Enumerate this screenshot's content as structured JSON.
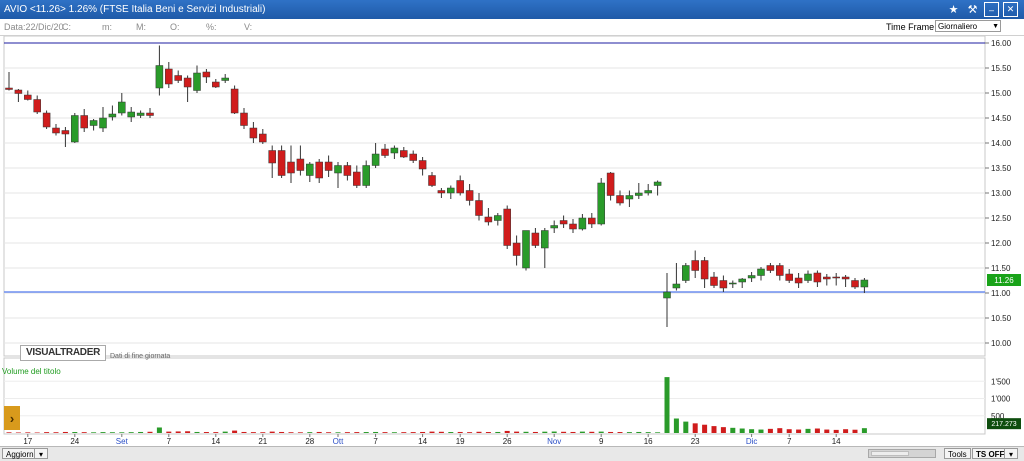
{
  "window": {
    "title": "AVIO <11.26> 1.26%  (FTSE Italia Beni e Servizi Industriali)",
    "icons": [
      "star-icon",
      "hammer-icon",
      "minimize-icon",
      "close-icon"
    ]
  },
  "infobar": {
    "date": "Data:22/Dic/20",
    "c": "C:",
    "m": "m:",
    "M": "M:",
    "o": "O:",
    "pct": "%:",
    "v": "V:",
    "timeframe_label": "Time Frame",
    "timeframe_value": "Giornaliero"
  },
  "chart": {
    "logo": "VISUALTRADER",
    "logo_sub": "Dati di fine giornata",
    "volume_label": "Volume del titolo",
    "price_label": "11.26",
    "volume_value_label": "217.273"
  },
  "colors": {
    "up": "#2a9b2a",
    "down": "#d01c1c",
    "support_line": "#6f8ff0",
    "top_line": "#1c1ca0",
    "price_box": "#19a319",
    "volume_box": "#0e4d0e"
  },
  "chart_data": {
    "type": "candlestick",
    "y_axis": {
      "range": [
        10.0,
        16.0
      ],
      "ticks": [
        "16.00",
        "15.50",
        "15.00",
        "14.50",
        "14.00",
        "13.50",
        "13.00",
        "12.50",
        "12.00",
        "11.50",
        "11.00",
        "10.50",
        "10.00"
      ]
    },
    "volume_axis": {
      "range": [
        0,
        2000
      ],
      "ticks": [
        "1'500",
        "1'000",
        "500"
      ]
    },
    "x_labels": [
      {
        "label": "17",
        "index": 2
      },
      {
        "label": "24",
        "index": 7
      },
      {
        "label": "Set",
        "index": 12
      },
      {
        "label": "7",
        "index": 17
      },
      {
        "label": "14",
        "index": 22
      },
      {
        "label": "21",
        "index": 27
      },
      {
        "label": "28",
        "index": 32
      },
      {
        "label": "Ott",
        "index": 35
      },
      {
        "label": "7",
        "index": 39
      },
      {
        "label": "14",
        "index": 44
      },
      {
        "label": "19",
        "index": 48
      },
      {
        "label": "26",
        "index": 53
      },
      {
        "label": "Nov",
        "index": 58
      },
      {
        "label": "9",
        "index": 63
      },
      {
        "label": "16",
        "index": 68
      },
      {
        "label": "23",
        "index": 73
      },
      {
        "label": "Dic",
        "index": 79
      },
      {
        "label": "7",
        "index": 83
      },
      {
        "label": "14",
        "index": 88
      }
    ],
    "horizontal_lines": [
      16.0,
      11.02
    ],
    "last_price": 11.26,
    "candles": [
      {
        "o": 15.1,
        "h": 15.42,
        "l": 15.05,
        "c": 15.07
      },
      {
        "o": 15.06,
        "h": 15.08,
        "l": 14.82,
        "c": 14.99
      },
      {
        "o": 14.96,
        "h": 15.05,
        "l": 14.85,
        "c": 14.87
      },
      {
        "o": 14.87,
        "h": 14.95,
        "l": 14.58,
        "c": 14.62
      },
      {
        "o": 14.6,
        "h": 14.65,
        "l": 14.28,
        "c": 14.32
      },
      {
        "o": 14.3,
        "h": 14.38,
        "l": 14.15,
        "c": 14.2
      },
      {
        "o": 14.25,
        "h": 14.32,
        "l": 13.92,
        "c": 14.18
      },
      {
        "o": 14.02,
        "h": 14.6,
        "l": 14.0,
        "c": 14.55
      },
      {
        "o": 14.55,
        "h": 14.68,
        "l": 14.22,
        "c": 14.3
      },
      {
        "o": 14.35,
        "h": 14.48,
        "l": 14.25,
        "c": 14.45
      },
      {
        "o": 14.3,
        "h": 14.72,
        "l": 14.22,
        "c": 14.5
      },
      {
        "o": 14.52,
        "h": 14.75,
        "l": 14.45,
        "c": 14.58
      },
      {
        "o": 14.6,
        "h": 15.0,
        "l": 14.55,
        "c": 14.82
      },
      {
        "o": 14.52,
        "h": 14.72,
        "l": 14.42,
        "c": 14.62
      },
      {
        "o": 14.55,
        "h": 14.65,
        "l": 14.5,
        "c": 14.6
      },
      {
        "o": 14.6,
        "h": 14.7,
        "l": 14.5,
        "c": 14.55
      },
      {
        "o": 15.1,
        "h": 15.95,
        "l": 14.95,
        "c": 15.55
      },
      {
        "o": 15.48,
        "h": 15.62,
        "l": 15.1,
        "c": 15.18
      },
      {
        "o": 15.35,
        "h": 15.45,
        "l": 15.2,
        "c": 15.25
      },
      {
        "o": 15.3,
        "h": 15.35,
        "l": 14.82,
        "c": 15.12
      },
      {
        "o": 15.05,
        "h": 15.55,
        "l": 15.0,
        "c": 15.4
      },
      {
        "o": 15.42,
        "h": 15.48,
        "l": 15.2,
        "c": 15.32
      },
      {
        "o": 15.22,
        "h": 15.28,
        "l": 15.1,
        "c": 15.12
      },
      {
        "o": 15.25,
        "h": 15.38,
        "l": 15.2,
        "c": 15.3
      },
      {
        "o": 15.08,
        "h": 15.15,
        "l": 14.58,
        "c": 14.6
      },
      {
        "o": 14.6,
        "h": 14.7,
        "l": 14.28,
        "c": 14.35
      },
      {
        "o": 14.3,
        "h": 14.42,
        "l": 14.0,
        "c": 14.1
      },
      {
        "o": 14.18,
        "h": 14.28,
        "l": 13.98,
        "c": 14.02
      },
      {
        "o": 13.85,
        "h": 13.95,
        "l": 13.3,
        "c": 13.6
      },
      {
        "o": 13.85,
        "h": 13.95,
        "l": 13.3,
        "c": 13.35
      },
      {
        "o": 13.62,
        "h": 13.95,
        "l": 13.2,
        "c": 13.4
      },
      {
        "o": 13.68,
        "h": 13.95,
        "l": 13.35,
        "c": 13.45
      },
      {
        "o": 13.35,
        "h": 13.62,
        "l": 13.22,
        "c": 13.58
      },
      {
        "o": 13.62,
        "h": 13.68,
        "l": 13.2,
        "c": 13.3
      },
      {
        "o": 13.62,
        "h": 13.75,
        "l": 13.32,
        "c": 13.45
      },
      {
        "o": 13.4,
        "h": 13.62,
        "l": 13.1,
        "c": 13.55
      },
      {
        "o": 13.55,
        "h": 13.62,
        "l": 13.25,
        "c": 13.35
      },
      {
        "o": 13.42,
        "h": 13.55,
        "l": 13.1,
        "c": 13.15
      },
      {
        "o": 13.15,
        "h": 13.65,
        "l": 13.1,
        "c": 13.55
      },
      {
        "o": 13.55,
        "h": 14.0,
        "l": 13.5,
        "c": 13.78
      },
      {
        "o": 13.88,
        "h": 13.98,
        "l": 13.7,
        "c": 13.75
      },
      {
        "o": 13.8,
        "h": 13.95,
        "l": 13.68,
        "c": 13.9
      },
      {
        "o": 13.85,
        "h": 13.92,
        "l": 13.7,
        "c": 13.72
      },
      {
        "o": 13.78,
        "h": 13.85,
        "l": 13.6,
        "c": 13.65
      },
      {
        "o": 13.65,
        "h": 13.72,
        "l": 13.35,
        "c": 13.48
      },
      {
        "o": 13.35,
        "h": 13.42,
        "l": 13.12,
        "c": 13.15
      },
      {
        "o": 13.05,
        "h": 13.1,
        "l": 12.9,
        "c": 13.0
      },
      {
        "o": 13.0,
        "h": 13.15,
        "l": 12.88,
        "c": 13.1
      },
      {
        "o": 13.25,
        "h": 13.35,
        "l": 12.95,
        "c": 13.0
      },
      {
        "o": 13.05,
        "h": 13.18,
        "l": 12.75,
        "c": 12.85
      },
      {
        "o": 12.85,
        "h": 13.0,
        "l": 12.45,
        "c": 12.55
      },
      {
        "o": 12.52,
        "h": 12.7,
        "l": 12.35,
        "c": 12.42
      },
      {
        "o": 12.45,
        "h": 12.6,
        "l": 12.35,
        "c": 12.55
      },
      {
        "o": 12.68,
        "h": 12.75,
        "l": 11.88,
        "c": 11.95
      },
      {
        "o": 12.0,
        "h": 12.15,
        "l": 11.55,
        "c": 11.75
      },
      {
        "o": 11.5,
        "h": 12.25,
        "l": 11.45,
        "c": 12.25
      },
      {
        "o": 12.2,
        "h": 12.3,
        "l": 11.9,
        "c": 11.95
      },
      {
        "o": 11.9,
        "h": 12.3,
        "l": 11.5,
        "c": 12.25
      },
      {
        "o": 12.3,
        "h": 12.45,
        "l": 12.2,
        "c": 12.35
      },
      {
        "o": 12.45,
        "h": 12.55,
        "l": 12.3,
        "c": 12.38
      },
      {
        "o": 12.38,
        "h": 12.48,
        "l": 12.2,
        "c": 12.28
      },
      {
        "o": 12.28,
        "h": 12.58,
        "l": 12.25,
        "c": 12.5
      },
      {
        "o": 12.5,
        "h": 12.6,
        "l": 12.3,
        "c": 12.38
      },
      {
        "o": 12.38,
        "h": 13.3,
        "l": 12.35,
        "c": 13.2
      },
      {
        "o": 13.4,
        "h": 13.42,
        "l": 12.85,
        "c": 12.95
      },
      {
        "o": 12.95,
        "h": 13.05,
        "l": 12.75,
        "c": 12.8
      },
      {
        "o": 12.88,
        "h": 13.05,
        "l": 12.72,
        "c": 12.95
      },
      {
        "o": 12.95,
        "h": 13.2,
        "l": 12.88,
        "c": 13.0
      },
      {
        "o": 13.0,
        "h": 13.18,
        "l": 12.95,
        "c": 13.05
      },
      {
        "o": 13.15,
        "h": 13.25,
        "l": 12.95,
        "c": 13.22
      },
      {
        "o": 10.9,
        "h": 11.4,
        "l": 10.32,
        "c": 11.02
      },
      {
        "o": 11.1,
        "h": 11.6,
        "l": 11.05,
        "c": 11.18
      },
      {
        "o": 11.25,
        "h": 11.6,
        "l": 11.2,
        "c": 11.55
      },
      {
        "o": 11.65,
        "h": 11.85,
        "l": 11.3,
        "c": 11.45
      },
      {
        "o": 11.65,
        "h": 11.72,
        "l": 11.1,
        "c": 11.28
      },
      {
        "o": 11.32,
        "h": 11.42,
        "l": 11.1,
        "c": 11.15
      },
      {
        "o": 11.25,
        "h": 11.35,
        "l": 11.02,
        "c": 11.1
      },
      {
        "o": 11.18,
        "h": 11.25,
        "l": 11.1,
        "c": 11.2
      },
      {
        "o": 11.22,
        "h": 11.3,
        "l": 11.1,
        "c": 11.28
      },
      {
        "o": 11.3,
        "h": 11.42,
        "l": 11.22,
        "c": 11.35
      },
      {
        "o": 11.35,
        "h": 11.52,
        "l": 11.25,
        "c": 11.48
      },
      {
        "o": 11.55,
        "h": 11.6,
        "l": 11.4,
        "c": 11.45
      },
      {
        "o": 11.55,
        "h": 11.6,
        "l": 11.25,
        "c": 11.35
      },
      {
        "o": 11.38,
        "h": 11.48,
        "l": 11.2,
        "c": 11.25
      },
      {
        "o": 11.3,
        "h": 11.4,
        "l": 11.1,
        "c": 11.2
      },
      {
        "o": 11.25,
        "h": 11.45,
        "l": 11.2,
        "c": 11.38
      },
      {
        "o": 11.4,
        "h": 11.45,
        "l": 11.12,
        "c": 11.22
      },
      {
        "o": 11.32,
        "h": 11.38,
        "l": 11.15,
        "c": 11.28
      },
      {
        "o": 11.32,
        "h": 11.4,
        "l": 11.15,
        "c": 11.3
      },
      {
        "o": 11.32,
        "h": 11.36,
        "l": 11.12,
        "c": 11.28
      },
      {
        "o": 11.25,
        "h": 11.3,
        "l": 11.08,
        "c": 11.12
      },
      {
        "o": 11.12,
        "h": 11.3,
        "l": 11.0,
        "c": 11.26
      }
    ],
    "volumes": [
      20,
      15,
      18,
      14,
      25,
      22,
      30,
      28,
      24,
      20,
      26,
      22,
      20,
      24,
      30,
      35,
      160,
      40,
      45,
      50,
      30,
      28,
      25,
      40,
      70,
      30,
      25,
      22,
      40,
      30,
      22,
      20,
      25,
      30,
      22,
      20,
      24,
      26,
      28,
      30,
      25,
      22,
      24,
      26,
      30,
      40,
      35,
      28,
      30,
      24,
      35,
      28,
      30,
      60,
      40,
      35,
      30,
      38,
      42,
      35,
      30,
      40,
      35,
      40,
      30,
      28,
      26,
      30,
      25,
      20,
      1620,
      420,
      330,
      280,
      240,
      200,
      170,
      150,
      130,
      110,
      100,
      120,
      140,
      110,
      100,
      120,
      130,
      100,
      90,
      110,
      95,
      140
    ]
  }
}
